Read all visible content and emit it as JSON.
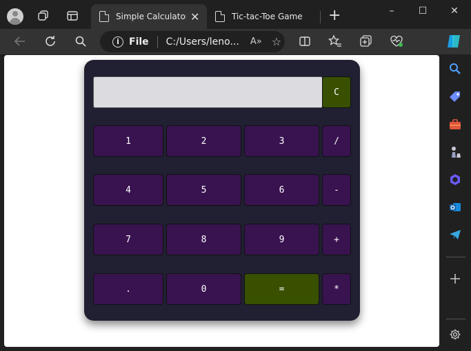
{
  "tabs": [
    {
      "label": "Simple Calculator u",
      "active": true
    },
    {
      "label": "Tic-tac-Toe Game",
      "active": false
    }
  ],
  "address": {
    "scheme_label": "File",
    "url": "C:/Users/leno...",
    "read_aloud": "A»"
  },
  "window_controls": {
    "minimize": "–",
    "maximize": "☐",
    "close": "✕"
  },
  "calculator": {
    "display_value": "",
    "clear_label": "C",
    "rows": [
      [
        "1",
        "2",
        "3",
        "/"
      ],
      [
        "4",
        "5",
        "6",
        "-"
      ],
      [
        "7",
        "8",
        "9",
        "+"
      ],
      [
        ".",
        "0",
        "=",
        "*"
      ]
    ]
  },
  "colors": {
    "calc_bg": "#202032",
    "key_purple": "#38134f",
    "key_green": "#385000",
    "display_bg": "#dcdce0"
  }
}
